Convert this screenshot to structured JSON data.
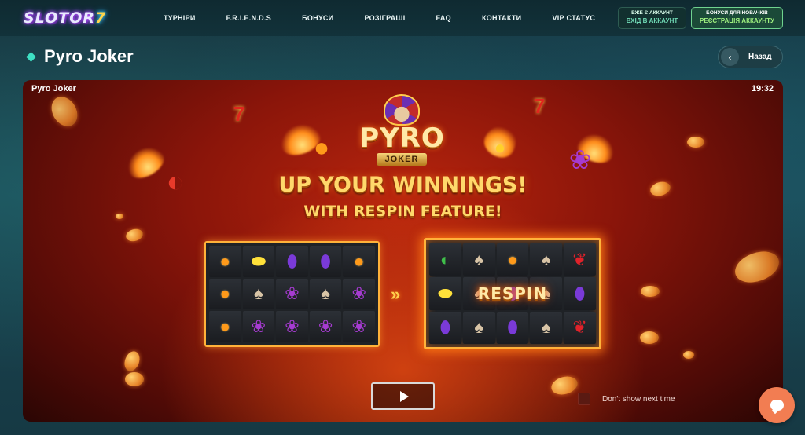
{
  "header": {
    "logo_text": "SLOTOR",
    "logo_seven": "7",
    "nav": [
      "ТУРНІРИ",
      "F.R.I.E.N.D.S",
      "БОНУСИ",
      "РОЗІГРАШІ",
      "FAQ",
      "КОНТАКТИ",
      "VIP СТАТУС"
    ],
    "login_small": "ВЖЕ Є АККАУНТ",
    "login_big": "ВХІД В АККАУНТ",
    "register_small": "БОНУСИ ДЛЯ НОВАЧКІВ",
    "register_big": "РЕЄСТРАЦІЯ АККАУНТУ"
  },
  "page": {
    "title": "Pyro Joker",
    "back_label": "Назад"
  },
  "game": {
    "frame_title": "Pyro Joker",
    "clock": "19:32",
    "logo_word": "PYRO",
    "logo_plate": "JOKER",
    "headline": "UP YOUR WINNINGS!",
    "subline": "WITH RESPIN FEATURE!",
    "respin_label": "RESPIN",
    "arrows": "»",
    "dont_show_label": "Don't show next time",
    "reels_left": [
      [
        "orange",
        "lemon",
        "plum",
        "plum",
        "orange"
      ],
      [
        "orange",
        "joker",
        "grape",
        "joker",
        "grape"
      ],
      [
        "orange",
        "grape",
        "grape",
        "grape",
        "grape"
      ]
    ],
    "reels_right": [
      [
        "melon",
        "joker",
        "orange",
        "joker",
        "cherry"
      ],
      [
        "lemon",
        "joker",
        "plum",
        "joker",
        "plum"
      ],
      [
        "plum",
        "joker",
        "plum",
        "joker",
        "cherry"
      ]
    ]
  },
  "colors": {
    "accent": "#3ee0c4",
    "chat": "#f27d52",
    "gold": "#ffd86b"
  }
}
